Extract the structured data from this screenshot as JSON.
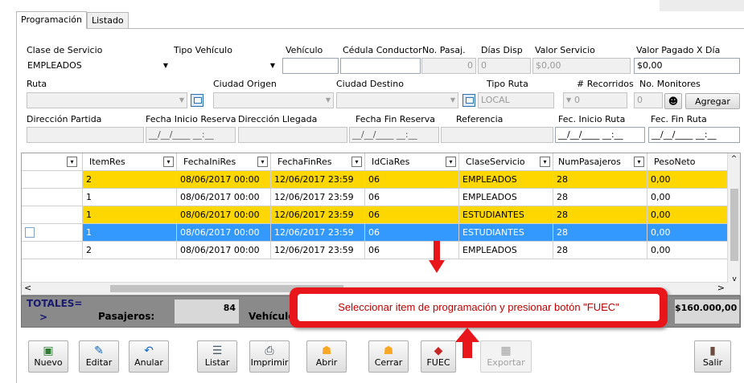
{
  "tabs": [
    "Programación",
    "Listado"
  ],
  "form": {
    "clase_servicio_label": "Clase de Servicio",
    "clase_servicio_value": "EMPLEADOS",
    "tipo_vehiculo_label": "Tipo Vehículo",
    "tipo_vehiculo_value": "",
    "vehiculo_label": "Vehículo",
    "vehiculo_value": "",
    "cedula_label": "Cédula Conductor",
    "cedula_value": "",
    "no_pasaj_label": "No. Pasaj.",
    "no_pasaj_value": "0",
    "dias_disp_label": "Días Disp",
    "dias_disp_value": "0",
    "valor_servicio_label": "Valor Servicio",
    "valor_servicio_value": "$0,00",
    "valor_pagado_label": "Valor Pagado X Día",
    "valor_pagado_value": "$0,00",
    "ruta_label": "Ruta",
    "ciudad_origen_label": "Ciudad Origen",
    "ciudad_destino_label": "Ciudad Destino",
    "tipo_ruta_label": "Tipo Ruta",
    "tipo_ruta_value": "LOCAL",
    "recorridos_label": "# Recorridos",
    "recorridos_value": "0",
    "monitores_label": "No. Monitores",
    "monitores_value": "0",
    "agregar_label": "Agregar",
    "direccion_partida_label": "Dirección Partida",
    "fecha_inicio_reserva_label": "Fecha Inicio Reserva",
    "fecha_inicio_reserva_value": "__/__/____ __:__",
    "direccion_llegada_label": "Dirección Llegada",
    "fecha_fin_reserva_label": "Fecha Fin Reserva",
    "fecha_fin_reserva_value": "__/__/____ __:__",
    "referencia_label": "Referencia",
    "fec_inicio_ruta_label": "Fec. Inicio Ruta",
    "fec_inicio_ruta_value": "__/__/____ __:__",
    "fec_fin_ruta_label": "Fec. Fin Ruta",
    "fec_fin_ruta_value": "__/__/____ __:__"
  },
  "grid": {
    "columns": [
      "ItemRes",
      "FechaIniRes",
      "FechaFinRes",
      "IdCiaRes",
      "ClaseServicio",
      "NumPasajeros",
      "PesoNeto"
    ],
    "rows": [
      {
        "item": "2",
        "ini": "08/06/2017 00:00",
        "fin": "12/06/2017 23:59",
        "cia": "06",
        "clase": "EMPLEADOS",
        "pasaj": "28",
        "peso": "0,00",
        "style": "yellow"
      },
      {
        "item": "1",
        "ini": "08/06/2017 00:00",
        "fin": "12/06/2017 23:59",
        "cia": "06",
        "clase": "EMPLEADOS",
        "pasaj": "28",
        "peso": "0,00",
        "style": "white"
      },
      {
        "item": "1",
        "ini": "08/06/2017 00:00",
        "fin": "12/06/2017 23:59",
        "cia": "06",
        "clase": "ESTUDIANTES",
        "pasaj": "28",
        "peso": "0,00",
        "style": "yellow"
      },
      {
        "item": "1",
        "ini": "08/06/2017 00:00",
        "fin": "12/06/2017 23:59",
        "cia": "06",
        "clase": "ESTUDIANTES",
        "pasaj": "28",
        "peso": "0,00",
        "style": "blue"
      },
      {
        "item": "2",
        "ini": "08/06/2017 00:00",
        "fin": "12/06/2017 23:59",
        "cia": "06",
        "clase": "EMPLEADOS",
        "pasaj": "28",
        "peso": "0,00",
        "style": "white"
      }
    ]
  },
  "totals": {
    "label": "TOTALES=",
    "arrow": ">",
    "pasajeros_label": "Pasajeros:",
    "pasajeros_value": "84",
    "vehiculos_label": "Vehículo",
    "total_value": "$160.000,00"
  },
  "callout": "Seleccionar item de programación y presionar botón \"FUEC\"",
  "toolbar": [
    "Nuevo",
    "Editar",
    "Anular",
    "Listar",
    "Imprimir",
    "Abrir",
    "Cerrar",
    "FUEC",
    "Exportar",
    "Salir"
  ],
  "colors": {
    "yellow": "#ffd700",
    "blue": "#3399ff",
    "callout": "#e8151b"
  }
}
